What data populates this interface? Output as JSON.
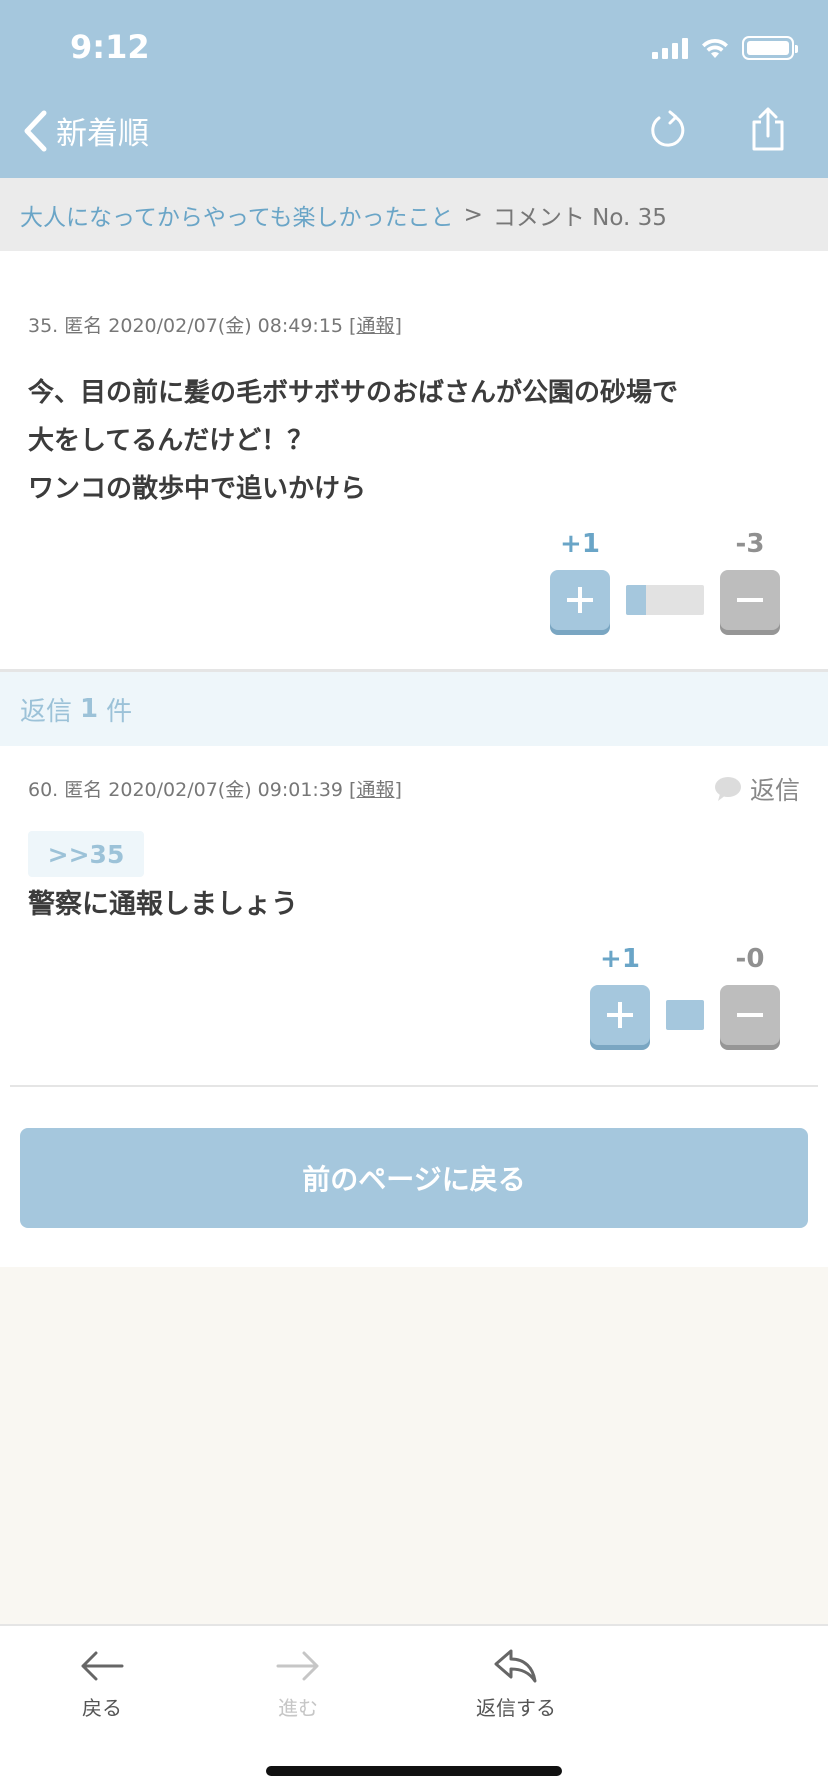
{
  "status_bar": {
    "time": "9:12"
  },
  "nav": {
    "back_label": "新着順"
  },
  "breadcrumb": {
    "link": "大人になってからやっても楽しかったこと",
    "separator": ">",
    "current": "コメント No. 35"
  },
  "main_comment": {
    "meta": "35. 匿名 2020/02/07(金) 08:49:15 ",
    "report_label": "[通報]",
    "body": "今、目の前に髪の毛ボサボサのおばさんが公園の砂場で\n大をしてるんだけど！？\nワンコの散歩中で追いかけら",
    "plus_label": "+1",
    "minus_label": "-3",
    "plus_ratio": 0.25
  },
  "replies_header": {
    "prefix": "返信",
    "count": "1",
    "suffix": "件"
  },
  "reply": {
    "meta": "60. 匿名 2020/02/07(金) 09:01:39 ",
    "report_label": "[通報]",
    "action_label": "返信",
    "anchor": ">>35",
    "body": "警察に通報しましょう",
    "plus_label": "+1",
    "minus_label": "-0",
    "plus_ratio": 1.0
  },
  "back_page_button": "前のページに戻る",
  "toolbar": {
    "back": "戻る",
    "forward": "進む",
    "reply": "返信する"
  },
  "colors": {
    "accent": "#a5c7dd",
    "link": "#6aa5c7",
    "background": "#f9f7f2"
  }
}
